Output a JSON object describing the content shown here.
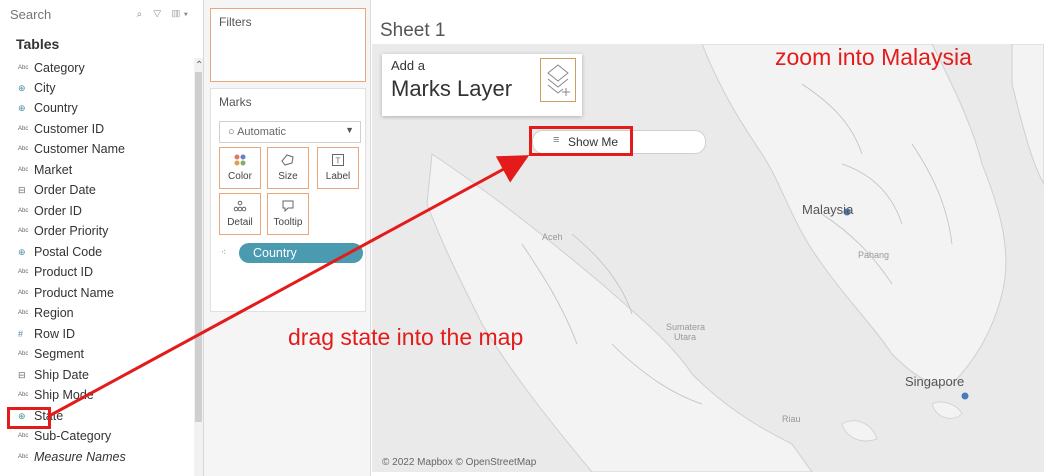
{
  "data_pane": {
    "search_placeholder": "Search",
    "tables_title": "Tables",
    "fields": [
      {
        "label": "Category",
        "type": "Abc"
      },
      {
        "label": "City",
        "type": "geo"
      },
      {
        "label": "Country",
        "type": "geo"
      },
      {
        "label": "Customer ID",
        "type": "Abc"
      },
      {
        "label": "Customer Name",
        "type": "Abc"
      },
      {
        "label": "Market",
        "type": "Abc"
      },
      {
        "label": "Order Date",
        "type": "date"
      },
      {
        "label": "Order ID",
        "type": "Abc"
      },
      {
        "label": "Order Priority",
        "type": "Abc"
      },
      {
        "label": "Postal Code",
        "type": "geo"
      },
      {
        "label": "Product ID",
        "type": "Abc"
      },
      {
        "label": "Product Name",
        "type": "Abc"
      },
      {
        "label": "Region",
        "type": "Abc"
      },
      {
        "label": "Row ID",
        "type": "number"
      },
      {
        "label": "Segment",
        "type": "Abc"
      },
      {
        "label": "Ship Date",
        "type": "date"
      },
      {
        "label": "Ship Mode",
        "type": "Abc"
      },
      {
        "label": "State",
        "type": "geo"
      },
      {
        "label": "Sub-Category",
        "type": "Abc"
      },
      {
        "label": "Measure Names",
        "type": "Abc",
        "italic": true
      }
    ]
  },
  "filters": {
    "title": "Filters"
  },
  "marks": {
    "title": "Marks",
    "mark_type": "Automatic",
    "buttons": [
      {
        "label": "Color",
        "icon": "color-dots-icon"
      },
      {
        "label": "Size",
        "icon": "size-icon"
      },
      {
        "label": "Label",
        "icon": "label-icon"
      },
      {
        "label": "Detail",
        "icon": "detail-icon"
      },
      {
        "label": "Tooltip",
        "icon": "tooltip-icon"
      }
    ],
    "pill": "Country"
  },
  "sheet": {
    "title": "Sheet 1"
  },
  "marks_layer": {
    "add": "Add a",
    "main": "Marks Layer"
  },
  "show_me": {
    "label": "Show Me"
  },
  "map": {
    "attribution": "© 2022 Mapbox © OpenStreetMap",
    "labels": {
      "malaysia": "Malaysia",
      "singapore": "Singapore",
      "aceh": "Aceh",
      "pahang": "Pahang",
      "sumatera": "Sumatera",
      "utara": "Utara",
      "riau": "Riau"
    }
  },
  "annotations": {
    "drag": "drag state into the map",
    "zoom": "zoom into Malaysia",
    "color": "#e41b1b"
  },
  "colors": {
    "pill": "#4a9ab0",
    "mark_dot": "#4a7ab8",
    "highlight_border": "#e8a87c"
  }
}
